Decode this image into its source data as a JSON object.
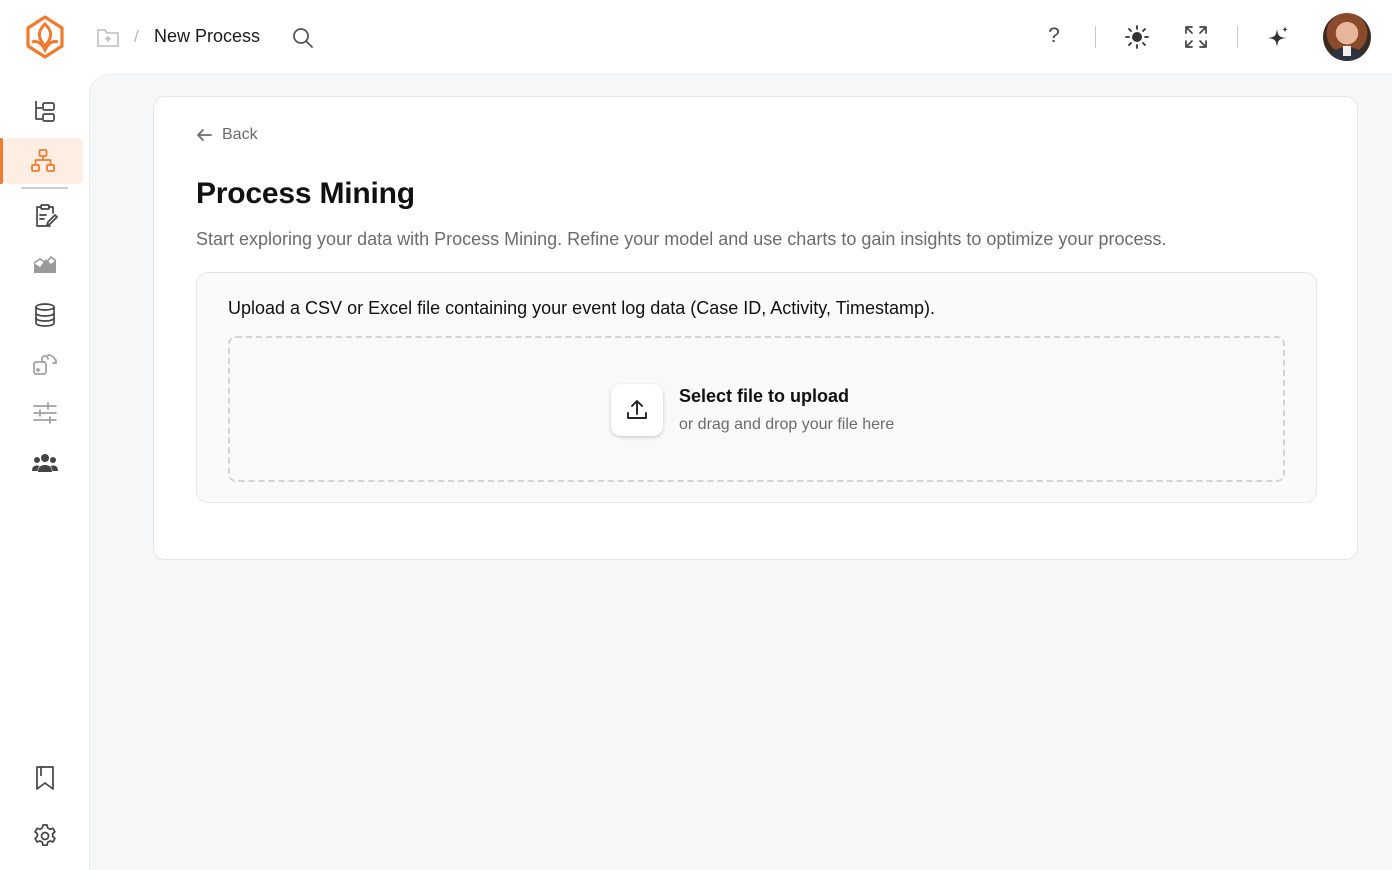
{
  "colors": {
    "accent": "#f07b2f",
    "content_bg": "#f6f7f8"
  },
  "header": {
    "breadcrumb_separator": "/",
    "title": "New Process",
    "help_label": "?"
  },
  "sidebar": {
    "items": [
      {
        "icon": "hierarchy-tree-icon"
      },
      {
        "icon": "process-diagram-icon",
        "active": true
      },
      {
        "icon": "clipboard-edit-icon"
      },
      {
        "icon": "chart-area-icon"
      },
      {
        "icon": "database-icon"
      },
      {
        "icon": "integration-icon"
      },
      {
        "icon": "sliders-icon"
      },
      {
        "icon": "users-icon"
      }
    ],
    "bottom": [
      {
        "icon": "bookmark-icon"
      },
      {
        "icon": "gear-icon"
      }
    ]
  },
  "main": {
    "back_label": "Back",
    "title": "Process Mining",
    "subtitle": "Start exploring your data with Process Mining. Refine your model and use charts to gain insights to optimize your process.",
    "upload": {
      "description": "Upload a CSV or Excel file containing your event log data (Case ID, Activity, Timestamp).",
      "select_label": "Select file to upload",
      "drag_hint": "or drag and drop your file here"
    }
  }
}
